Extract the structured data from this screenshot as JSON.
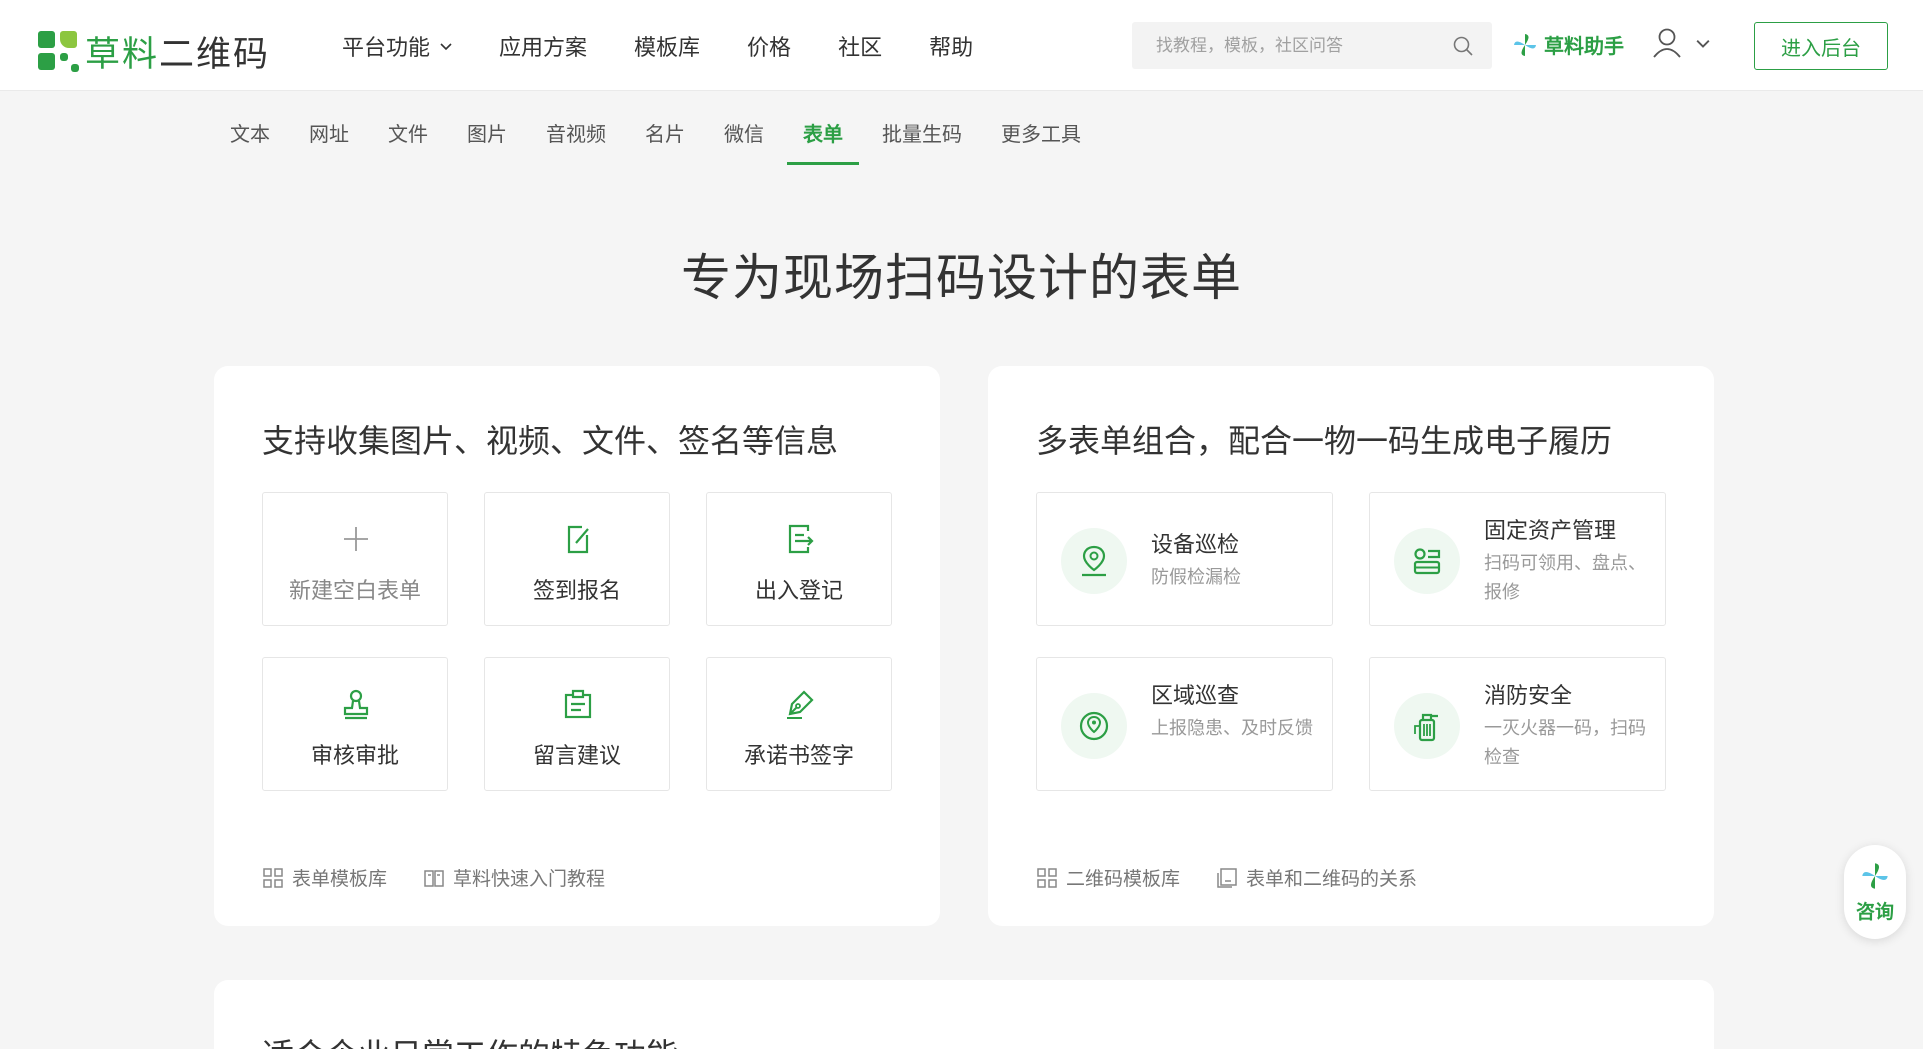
{
  "header": {
    "logo_text_green": "草料",
    "logo_text_rest": "二维码",
    "nav": [
      {
        "label": "平台功能",
        "has_dropdown": true
      },
      {
        "label": "应用方案"
      },
      {
        "label": "模板库"
      },
      {
        "label": "价格"
      },
      {
        "label": "社区"
      },
      {
        "label": "帮助"
      }
    ],
    "search_placeholder": "找教程，模板，社区问答",
    "assistant_label": "草料助手",
    "admin_button": "进入后台"
  },
  "subnav": {
    "items": [
      "文本",
      "网址",
      "文件",
      "图片",
      "音视频",
      "名片",
      "微信",
      "表单",
      "批量生码",
      "更多工具"
    ],
    "active": "表单"
  },
  "hero_title": "专为现场扫码设计的表单",
  "card_left": {
    "title": "支持收集图片、视频、文件、签名等信息",
    "tiles": [
      {
        "label": "新建空白表单",
        "icon": "plus-icon"
      },
      {
        "label": "签到报名",
        "icon": "edit-note-icon"
      },
      {
        "label": "出入登记",
        "icon": "exit-log-icon"
      },
      {
        "label": "审核审批",
        "icon": "stamp-icon"
      },
      {
        "label": "留言建议",
        "icon": "clipboard-icon"
      },
      {
        "label": "承诺书签字",
        "icon": "pen-sign-icon"
      }
    ],
    "footer_links": [
      {
        "label": "表单模板库",
        "icon": "grid-icon"
      },
      {
        "label": "草料快速入门教程",
        "icon": "book-icon"
      }
    ]
  },
  "card_right": {
    "title": "多表单组合，配合一物一码生成电子履历",
    "tiles": [
      {
        "title": "设备巡检",
        "desc": "防假检漏检",
        "icon": "location-pin-icon"
      },
      {
        "title": "固定资产管理",
        "desc": "扫码可领用、盘点、报修",
        "icon": "asset-icon"
      },
      {
        "title": "区域巡查",
        "desc": "上报隐患、及时反馈",
        "icon": "area-pin-icon"
      },
      {
        "title": "消防安全",
        "desc": "一灭火器一码，扫码检查",
        "icon": "fire-extinguisher-icon"
      }
    ],
    "footer_links": [
      {
        "label": "二维码模板库",
        "icon": "grid-icon"
      },
      {
        "label": "表单和二维码的关系",
        "icon": "copy-doc-icon"
      }
    ]
  },
  "consult_label": "咨询",
  "bottom_card_title": "适合企业日常工作的特色功能",
  "colors": {
    "accent": "#2c9f45",
    "accent_light": "#eff8f1",
    "background": "#f5f5f5"
  }
}
